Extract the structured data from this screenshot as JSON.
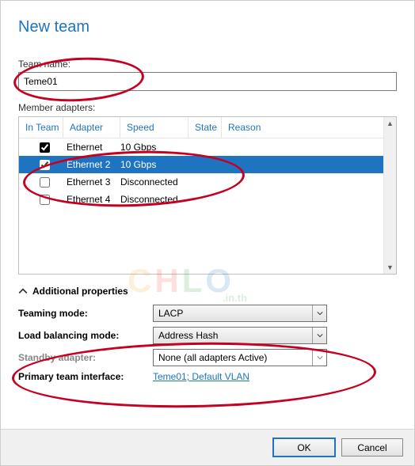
{
  "window_title": "New team",
  "team_name": {
    "label": "Team name:",
    "value": "Teme01"
  },
  "member_adapters": {
    "label": "Member adapters:",
    "columns": {
      "in_team": "In Team",
      "adapter": "Adapter",
      "speed": "Speed",
      "state": "State",
      "reason": "Reason"
    },
    "rows": [
      {
        "checked": true,
        "selected": false,
        "adapter": "Ethernet",
        "speed": "10 Gbps"
      },
      {
        "checked": true,
        "selected": true,
        "adapter": "Ethernet 2",
        "speed": "10 Gbps"
      },
      {
        "checked": false,
        "selected": false,
        "adapter": "Ethernet 3",
        "speed": "Disconnected"
      },
      {
        "checked": false,
        "selected": false,
        "adapter": "Ethernet 4",
        "speed": "Disconnected"
      }
    ]
  },
  "additional": {
    "header": "Additional properties",
    "teaming_mode": {
      "label": "Teaming mode:",
      "value": "LACP"
    },
    "load_balancing": {
      "label": "Load balancing mode:",
      "value": "Address Hash"
    },
    "standby": {
      "label": "Standby adapter:",
      "value": "None (all adapters Active)"
    },
    "primary_iface": {
      "label": "Primary team interface:",
      "value": "Teme01; Default VLAN"
    }
  },
  "buttons": {
    "ok": "OK",
    "cancel": "Cancel"
  },
  "watermark": {
    "text_chars": [
      "C",
      "H",
      "L",
      "O"
    ],
    "suffix": ".in.th"
  }
}
